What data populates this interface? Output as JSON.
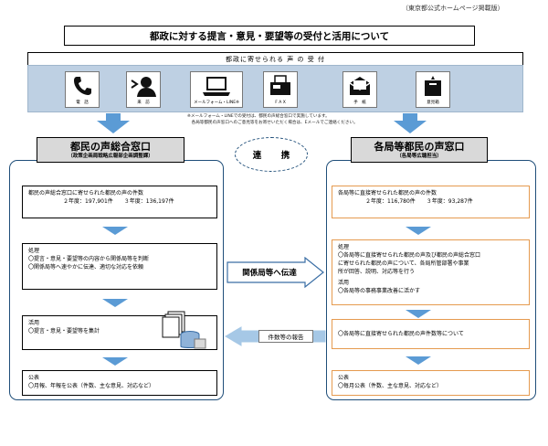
{
  "source_note": "（東京都公式ホームページ掲載版）",
  "title": "都政に対する提言・意見・要望等の受付と活用について",
  "reception": {
    "banner": "都政に寄せられる 声 の 受 付",
    "channels": [
      {
        "label": "電　話",
        "icon": "phone-icon"
      },
      {
        "label": "来　訪",
        "icon": "visitor-speaking-icon"
      },
      {
        "label": "メールフォーム・LINE※",
        "icon": "laptop-icon"
      },
      {
        "label": "F A X",
        "icon": "fax-icon"
      },
      {
        "label": "手　紙",
        "icon": "letter-icon"
      },
      {
        "label": "意見箱",
        "icon": "suggestion-box-icon"
      }
    ],
    "notes": [
      "※メールフォーム・LINEでの受付は、都民の声総合窓口で実施しています。",
      "　各局等都民の声窓口へのご意見等をお寄せいただく場合は、Eメールでご連絡ください。"
    ]
  },
  "renkei": "連　携",
  "left": {
    "title": "都民の声総合窓口",
    "subtitle": "（政策企画局戦略広報部企画調整課）",
    "count_box": {
      "line1": "都民の声総合窓口に寄せられた都民の声の件数",
      "line2": "２年度：197,901件　　３年度：136,197件"
    },
    "processing_box": {
      "heading": "処理",
      "lines": [
        "〇提言・意見・要望等の内容から関係局等を判断",
        "〇関係局等へ速やかに伝達、適切な対応を依頼"
      ]
    },
    "utilization_box": {
      "heading": "活用",
      "lines": [
        "〇提言・意見・要望等を集計"
      ]
    },
    "publication_box": {
      "heading": "公表",
      "lines": [
        "〇月報、年報を公表（件数、主な意見、対応など）"
      ]
    }
  },
  "right": {
    "title": "各局等都民の声窓口",
    "subtitle": "（各局等広聴担当）",
    "count_box": {
      "line1": "各局等に直接寄せられた都民の声の件数",
      "line2": "２年度：116,780件　　３年度：93,287件"
    },
    "processing_box": {
      "heading": "処理",
      "lines": [
        "〇各局等に直接寄せられた都民の声及び都民の声総合窓口",
        "に寄せられた都民の声について、各局所管部署や事業",
        "所が回答、説明、対応等を行う"
      ],
      "heading2": "活用",
      "lines2": [
        "〇各局等の事務事業改善に活かす"
      ]
    },
    "report_box": {
      "lines": [
        "〇各局等に直接寄せられた都民の声件数等について"
      ]
    },
    "publication_box": {
      "heading": "公表",
      "lines": [
        "〇毎月公表（件数、主な意見、対応など）"
      ]
    }
  },
  "flows": {
    "to_departments": "関係局等へ伝達",
    "report_back": "件数等の報告"
  }
}
